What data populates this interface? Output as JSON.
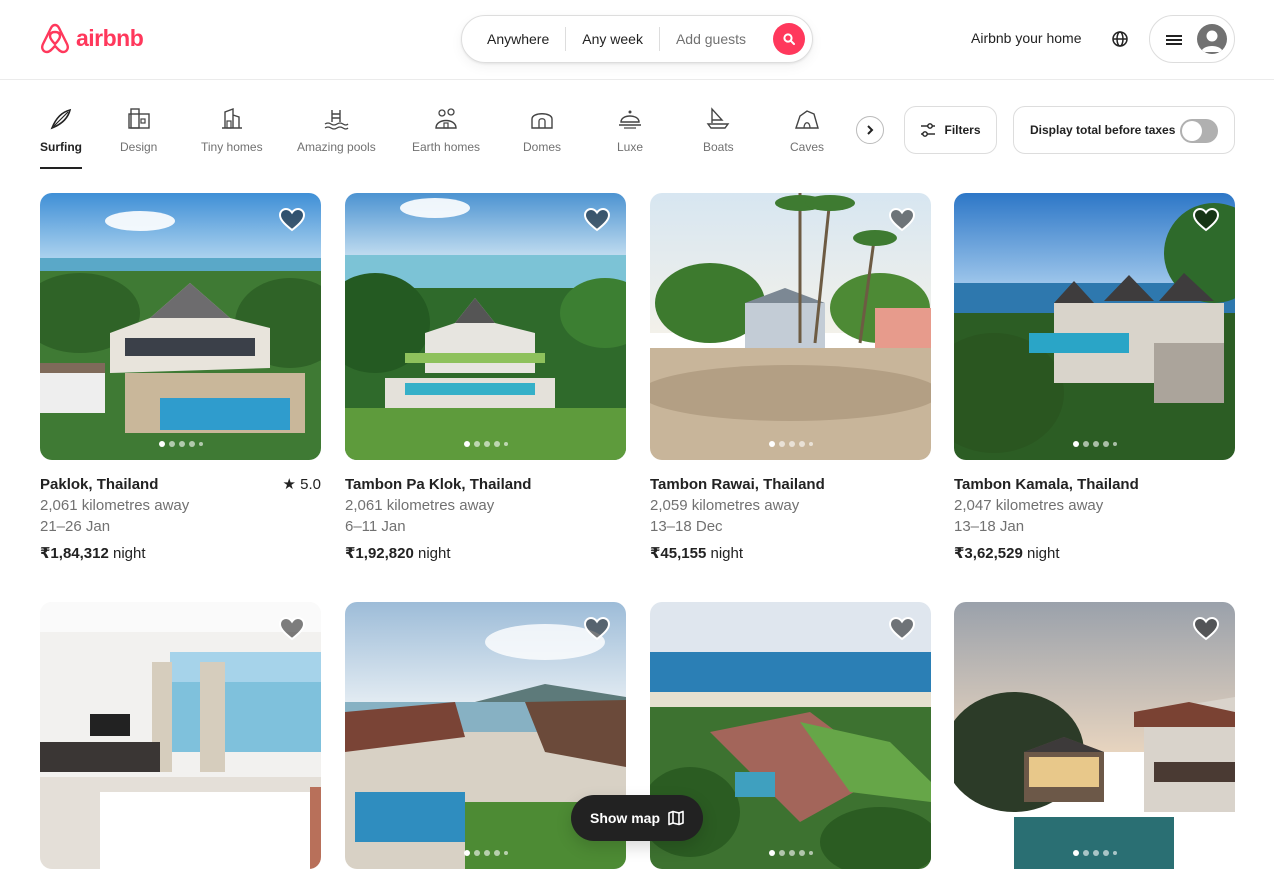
{
  "brand": {
    "name": "airbnb",
    "color": "#ff385c"
  },
  "search": {
    "location": "Anywhere",
    "dates": "Any week",
    "guests_placeholder": "Add guests",
    "button_icon": "search-icon"
  },
  "header": {
    "host_link": "Airbnb your home",
    "globe_icon": "globe-icon",
    "menu_icon": "hamburger-icon",
    "avatar_icon": "avatar-icon"
  },
  "categories": [
    {
      "label": "Surfing",
      "icon": "surfboard-icon",
      "active": true
    },
    {
      "label": "Design",
      "icon": "design-building-icon",
      "active": false
    },
    {
      "label": "Tiny homes",
      "icon": "tiny-home-icon",
      "active": false
    },
    {
      "label": "Amazing pools",
      "icon": "pool-icon",
      "active": false
    },
    {
      "label": "Earth homes",
      "icon": "earth-home-icon",
      "active": false
    },
    {
      "label": "Domes",
      "icon": "dome-icon",
      "active": false
    },
    {
      "label": "Luxe",
      "icon": "luxe-bell-icon",
      "active": false
    },
    {
      "label": "Boats",
      "icon": "boat-icon",
      "active": false
    },
    {
      "label": "Caves",
      "icon": "cave-icon",
      "active": false
    }
  ],
  "toolbar": {
    "filters_label": "Filters",
    "taxes_label": "Display total before taxes",
    "taxes_toggle_on": false
  },
  "listings": [
    {
      "location": "Paklok, Thailand",
      "distance": "2,061 kilometres away",
      "dates": "21–26 Jan",
      "price": "₹1,84,312",
      "per": "night",
      "rating": "5.0"
    },
    {
      "location": "Tambon Pa Klok, Thailand",
      "distance": "2,061 kilometres away",
      "dates": "6–11 Jan",
      "price": "₹1,92,820",
      "per": "night",
      "rating": ""
    },
    {
      "location": "Tambon Rawai, Thailand",
      "distance": "2,059 kilometres away",
      "dates": "13–18 Dec",
      "price": "₹45,155",
      "per": "night",
      "rating": ""
    },
    {
      "location": "Tambon Kamala, Thailand",
      "distance": "2,047 kilometres away",
      "dates": "13–18 Jan",
      "price": "₹3,62,529",
      "per": "night",
      "rating": ""
    }
  ],
  "show_map_label": "Show map"
}
